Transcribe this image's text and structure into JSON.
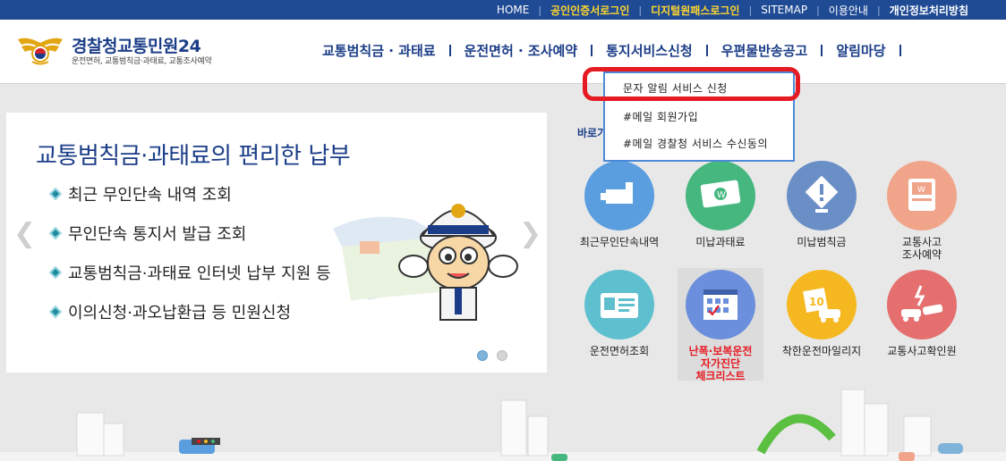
{
  "topbar": {
    "links": [
      {
        "label": "HOME",
        "style": "normal"
      },
      {
        "label": "공인인증서로그인",
        "style": "yellow"
      },
      {
        "label": "디지털원패스로그인",
        "style": "yellow"
      },
      {
        "label": "SITEMAP",
        "style": "normal"
      },
      {
        "label": "이용안내",
        "style": "normal"
      },
      {
        "label": "개인정보처리방침",
        "style": "bold"
      }
    ],
    "colors": {
      "bg": "#1f4a94",
      "accent": "#ffd82e"
    }
  },
  "logo": {
    "title_main": "경찰청",
    "title_rest": "교통민원24",
    "subtitle": "운전면허, 교통범칙금·과태료, 교통조사예약"
  },
  "gnb": {
    "items": [
      "교통범칙금 · 과태료",
      "운전면허 · 조사예약",
      "통지서비스신청",
      "우편물반송공고",
      "알림마당"
    ]
  },
  "dropdown": {
    "items": [
      "문자 알림 서비스 신청",
      "#메일 회원가입",
      "#메일 경찰청 서비스 수신동의"
    ]
  },
  "slider": {
    "headline": "교통범칙금·과태료의 편리한 납부",
    "bullets": [
      "최근 무인단속 내역 조회",
      "무인단속 통지서 발급 조회",
      "교통범칙금·과태료 인터넷 납부 지원 등",
      "이의신청·과오납환급 등 민원신청"
    ],
    "prev_icon": "chevron-left-icon",
    "next_icon": "chevron-right-icon",
    "active_slide": 1,
    "slide_count": 2
  },
  "quick": {
    "label": "바로가",
    "services": [
      {
        "label": "최근무인단속내역",
        "icon": "camera-icon",
        "color": "#5b9ee0"
      },
      {
        "label": "미납과태료",
        "icon": "money-icon",
        "color": "#45b77f"
      },
      {
        "label": "미납범칙금",
        "icon": "warning-icon",
        "color": "#6a8fc7"
      },
      {
        "label": "교통사고\n조사예약",
        "icon": "payment-terminal-icon",
        "color": "#f0a58a"
      },
      {
        "label": "운전면허조회",
        "icon": "license-card-icon",
        "color": "#5ec0cf"
      },
      {
        "label": "난폭·보복운전\n자가진단\n체크리스트",
        "icon": "calendar-check-icon",
        "color": "#6b8fdc",
        "red": true
      },
      {
        "label": "착한운전마일리지",
        "icon": "mileage-icon",
        "color": "#f5b820"
      },
      {
        "label": "교통사고확인원",
        "icon": "car-crash-icon",
        "color": "#e56f6f"
      }
    ]
  }
}
